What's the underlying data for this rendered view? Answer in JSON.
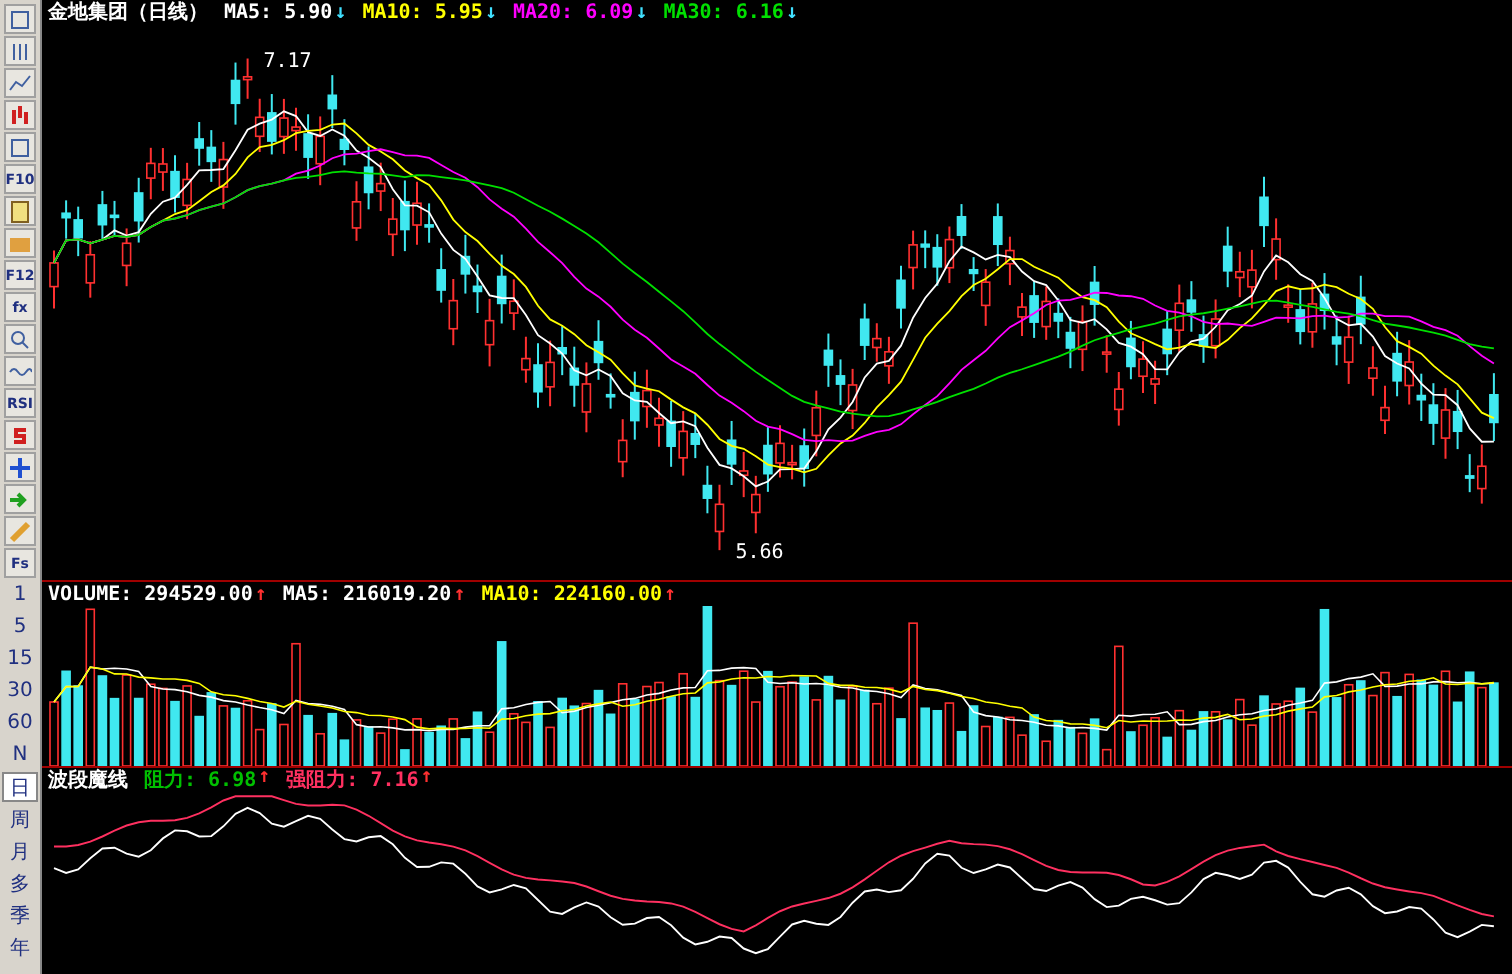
{
  "toolbar": [
    {
      "kind": "icon"
    },
    {
      "kind": "icon"
    },
    {
      "kind": "icon"
    },
    {
      "kind": "icon"
    },
    {
      "kind": "icon"
    },
    {
      "kind": "key",
      "label": "F10"
    },
    {
      "kind": "icon"
    },
    {
      "kind": "icon"
    },
    {
      "kind": "key",
      "label": "F12"
    },
    {
      "kind": "key",
      "label": "fx"
    },
    {
      "kind": "icon"
    },
    {
      "kind": "icon"
    },
    {
      "kind": "key",
      "label": "RSI"
    },
    {
      "kind": "icon"
    },
    {
      "kind": "icon"
    },
    {
      "kind": "icon"
    },
    {
      "kind": "icon"
    },
    {
      "kind": "key",
      "label": "Fs"
    }
  ],
  "periods": [
    {
      "label": "1",
      "selected": false
    },
    {
      "label": "5",
      "selected": false
    },
    {
      "label": "15",
      "selected": false
    },
    {
      "label": "30",
      "selected": false
    },
    {
      "label": "60",
      "selected": false
    },
    {
      "label": "N",
      "selected": false
    },
    {
      "label": "日",
      "selected": true
    },
    {
      "label": "周",
      "selected": false
    },
    {
      "label": "月",
      "selected": false
    },
    {
      "label": "多",
      "selected": false
    },
    {
      "label": "季",
      "selected": false
    },
    {
      "label": "年",
      "selected": false
    }
  ],
  "price_chart": {
    "title": "金地集团（日线）",
    "indicators": [
      {
        "label": "MA5: 5.90",
        "arrow": "↓",
        "color": "#ffffff"
      },
      {
        "label": "MA10: 5.95",
        "arrow": "↓",
        "color": "#ffff00"
      },
      {
        "label": "MA20: 6.09",
        "arrow": "↓",
        "color": "#ff00ff"
      },
      {
        "label": "MA30: 6.16",
        "arrow": "↓",
        "color": "#00e000"
      }
    ],
    "high_label": "7.17",
    "low_label": "5.66"
  },
  "volume_chart": {
    "indicators": [
      {
        "label": "VOLUME: 294529.00",
        "arrow": "↑",
        "color": "#ffffff"
      },
      {
        "label": "MA5: 216019.20",
        "arrow": "↑",
        "color": "#ffffff"
      },
      {
        "label": "MA10: 224160.00",
        "arrow": "↑",
        "color": "#ffff00"
      }
    ]
  },
  "indicator_chart": {
    "title": "波段魔线",
    "indicators": [
      {
        "label": "阻力: 6.98",
        "arrow": "↑",
        "color": "#00c000"
      },
      {
        "label": "强阻力: 7.16",
        "arrow": "↑",
        "color": "#ff3060"
      }
    ]
  }
}
